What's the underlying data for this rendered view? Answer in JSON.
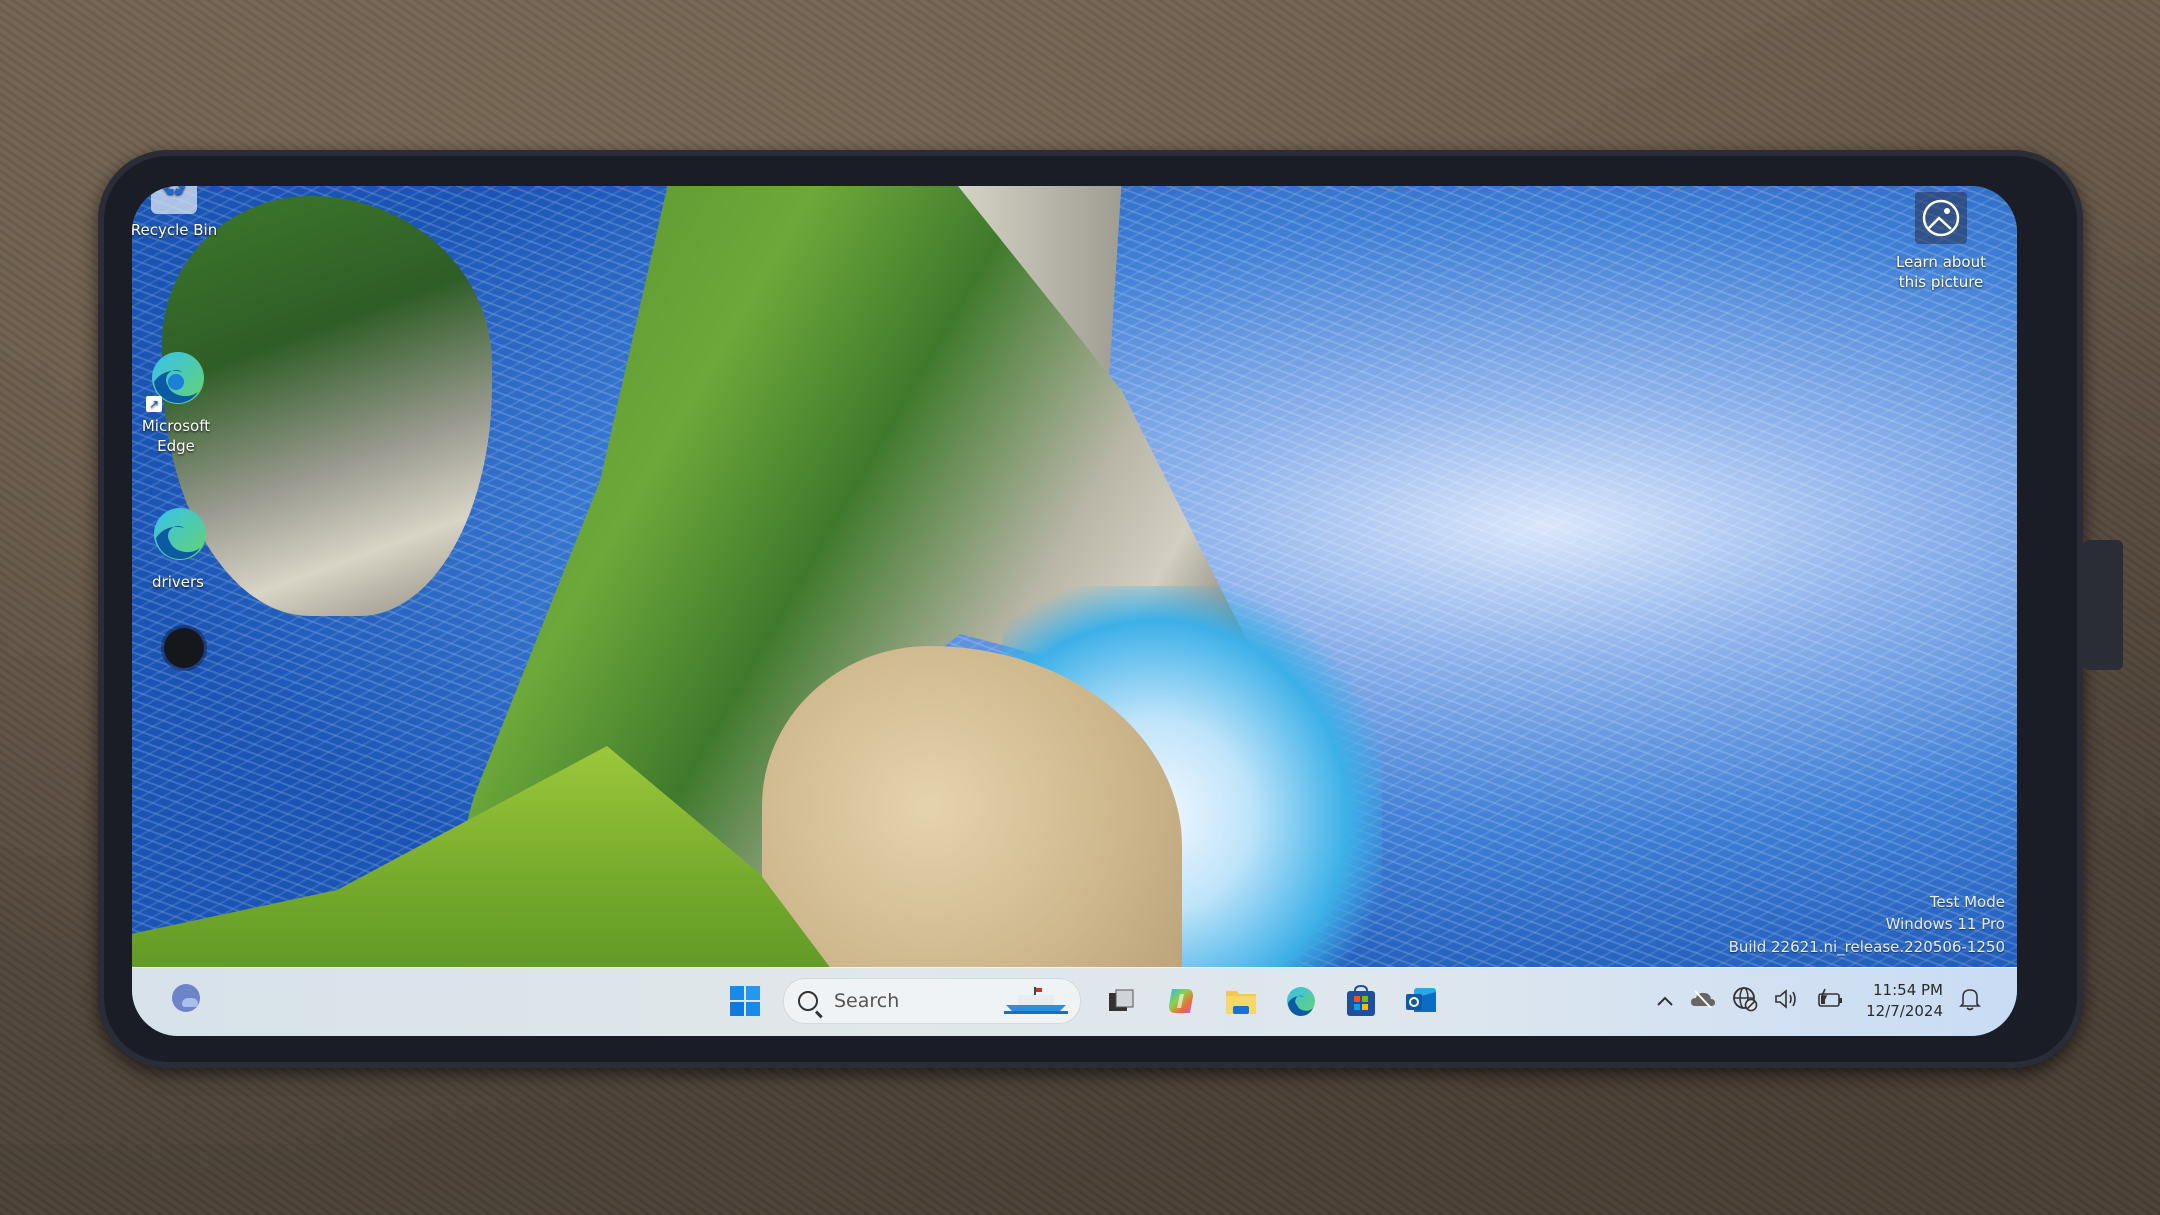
{
  "desktop": {
    "icons": [
      {
        "label": "Recycle Bin",
        "icon": "recycle-bin-icon"
      },
      {
        "label": "Microsoft Edge",
        "icon": "edge-shortcut-icon"
      },
      {
        "label": "drivers",
        "icon": "edge-icon"
      }
    ],
    "learn_about": {
      "label": "Learn about this picture",
      "icon": "image-info-icon"
    },
    "watermark": {
      "line1": "Test Mode",
      "line2": "Windows 11 Pro",
      "line3": "Build 22621.ni_release.220506-1250"
    }
  },
  "taskbar": {
    "widgets_icon": "weather-moon-cloud-icon",
    "start_icon": "windows-start-icon",
    "search": {
      "placeholder": "Search",
      "icon": "search-icon",
      "highlight": "boat-search-highlight"
    },
    "apps": [
      {
        "name": "Task View",
        "icon": "task-view-icon"
      },
      {
        "name": "Copilot",
        "icon": "copilot-icon"
      },
      {
        "name": "File Explorer",
        "icon": "folder-icon"
      },
      {
        "name": "Microsoft Edge",
        "icon": "edge-icon"
      },
      {
        "name": "Microsoft Store",
        "icon": "store-icon"
      },
      {
        "name": "Outlook",
        "icon": "outlook-icon"
      }
    ],
    "tray": {
      "overflow_icon": "chevron-up-icon",
      "onedrive_icon": "onedrive-offline-icon",
      "network_icon": "globe-no-internet-icon",
      "volume_icon": "speaker-icon",
      "battery_icon": "battery-charging-icon",
      "time": "11:54 PM",
      "date": "12/7/2024",
      "notification_icon": "bell-icon"
    }
  }
}
